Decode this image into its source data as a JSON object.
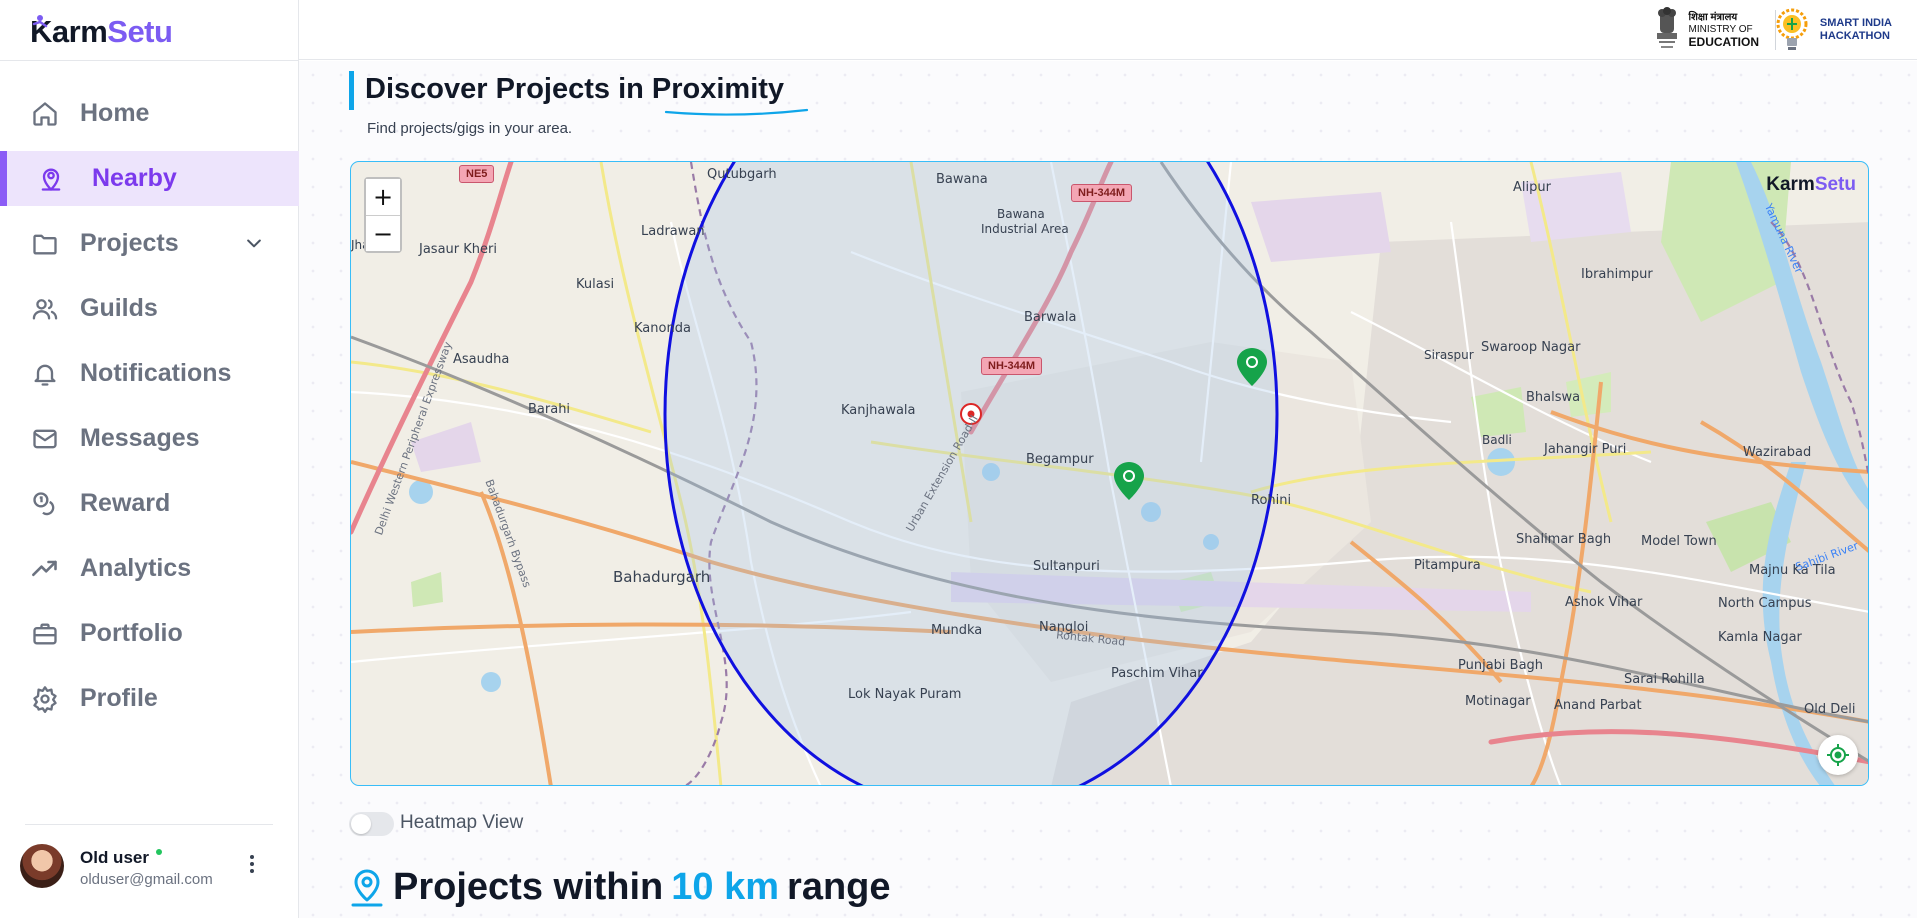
{
  "brand": {
    "name_a": "Karm",
    "name_b": "Setu",
    "accent": "#7c5cf2"
  },
  "header": {
    "moe_hindi": "शिक्षा मंत्रालय",
    "moe_line1": "MINISTRY OF",
    "moe_line2": "EDUCATION",
    "sih_line1": "SMART INDIA",
    "sih_line2": "HACKATHON"
  },
  "sidebar": {
    "items": [
      {
        "label": "Home",
        "icon": "home-icon"
      },
      {
        "label": "Nearby",
        "icon": "location-user-icon",
        "active": true
      },
      {
        "label": "Projects",
        "icon": "folder-icon",
        "expandable": true
      },
      {
        "label": "Guilds",
        "icon": "users-icon"
      },
      {
        "label": "Notifications",
        "icon": "bell-icon"
      },
      {
        "label": "Messages",
        "icon": "mail-icon"
      },
      {
        "label": "Reward",
        "icon": "coins-icon"
      },
      {
        "label": "Analytics",
        "icon": "trending-up-icon"
      },
      {
        "label": "Portfolio",
        "icon": "briefcase-icon"
      },
      {
        "label": "Profile",
        "icon": "gear-icon"
      }
    ],
    "user": {
      "name": "Old user",
      "email": "olduser@gmail.com",
      "status": "online"
    }
  },
  "main": {
    "title_prefix": "Discover Projects in ",
    "title_highlight": "Proximity",
    "subtitle": "Find projects/gigs in your area.",
    "heatmap_label": "Heatmap View",
    "heatmap_on": false,
    "section_prefix": "Projects within",
    "section_range": "10 km",
    "section_suffix": "range"
  },
  "map": {
    "zoom_in": "+",
    "zoom_out": "−",
    "watermark_a": "Karm",
    "watermark_b": "Setu",
    "radius_color": "#1010e0",
    "marker_color": "#16a34a",
    "user_marker_color": "#dc2626",
    "places": {
      "qutubgarh": "Qutubgarh",
      "bawana": "Bawana",
      "bawana_ia_1": "Bawana",
      "bawana_ia_2": "Industrial Area",
      "alipur": "Alipur",
      "ladrawan": "Ladrawan",
      "jasaur_kheri": "Jasaur Kheri",
      "kulasi": "Kulasi",
      "ibrahimpur": "Ibrahimpur",
      "kanonda": "Kanonda",
      "barwala": "Barwala",
      "siraspur": "Siraspur",
      "swaroop_nagar": "Swaroop Nagar",
      "asaudha": "Asaudha",
      "bhalswa": "Bhalswa",
      "barahi": "Barahi",
      "kanjhawala": "Kanjhawala",
      "badli": "Badli",
      "jahangir_puri": "Jahangir Puri",
      "wazirabad": "Wazirabad",
      "begampur": "Begampur",
      "rohini": "Rohini",
      "shalimar_bagh": "Shalimar Bagh",
      "model_town": "Model Town",
      "sultanpuri": "Sultanpuri",
      "pitampura": "Pitampura",
      "majnu_ka_tila": "Majnu Ka Tila",
      "bahadurgarh": "Bahadurgarh",
      "ashok_vihar": "Ashok Vihar",
      "north_campus": "North Campus",
      "mundka": "Mundka",
      "nangloi": "Nangloi",
      "kamla_nagar": "Kamla Nagar",
      "paschim_vihar": "Paschim Vihar",
      "punjabi_bagh": "Punjabi Bagh",
      "sarai_rohilla": "Sarai Rohilla",
      "lok_nayak_puram": "Lok Nayak Puram",
      "motinagar": "Motinagar",
      "anand_parbat": "Anand Parbat",
      "old_delhi": "Old Deli",
      "rohtak_road": "Rohtak Road",
      "urban_ext_road": "Urban Extension Road-II",
      "bahadurgarh_bypass": "Bahadurgarh Bypass",
      "delhi_western_peripheral": "Delhi Western Peripheral Expressway",
      "yamuna_river": "Yamuna River",
      "sahibi_river": "Sahibi River",
      "jhauli": "Jhauli",
      "ne5": "NE5",
      "nh344m_a": "NH-344M",
      "nh344m_b": "NH-344M"
    }
  }
}
